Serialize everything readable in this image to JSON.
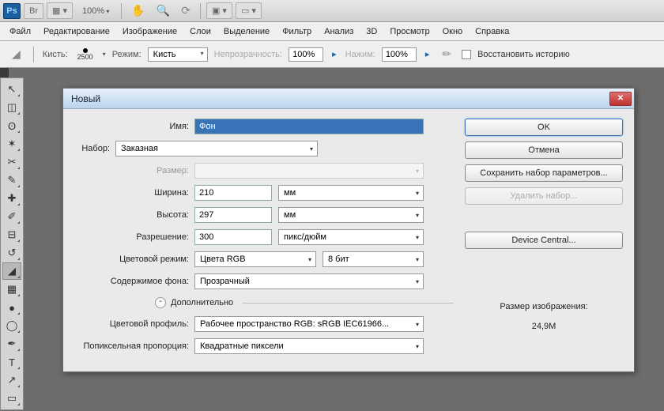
{
  "topbar": {
    "br": "Br",
    "zoom": "100%"
  },
  "menu": [
    "Файл",
    "Редактирование",
    "Изображение",
    "Слои",
    "Выделение",
    "Фильтр",
    "Анализ",
    "3D",
    "Просмотр",
    "Окно",
    "Справка"
  ],
  "options": {
    "brush_label": "Кисть:",
    "brush_size": "2500",
    "mode_label": "Режим:",
    "mode_value": "Кисть",
    "opacity_label": "Непрозрачность:",
    "opacity_value": "100%",
    "flow_label": "Нажим:",
    "flow_value": "100%",
    "restore": "Восстановить историю"
  },
  "dialog": {
    "title": "Новый",
    "labels": {
      "name": "Имя:",
      "preset": "Набор:",
      "size": "Размер:",
      "width": "Ширина:",
      "height": "Высота:",
      "resolution": "Разрешение:",
      "color_mode": "Цветовой режим:",
      "bg": "Содержимое фона:",
      "advanced": "Дополнительно",
      "profile": "Цветовой профиль:",
      "aspect": "Попиксельная пропорция:"
    },
    "values": {
      "name": "Фон",
      "preset": "Заказная",
      "width": "210",
      "width_unit": "мм",
      "height": "297",
      "height_unit": "мм",
      "resolution": "300",
      "resolution_unit": "пикс/дюйм",
      "color_mode": "Цвета RGB",
      "bit_depth": "8 бит",
      "bg": "Прозрачный",
      "profile": "Рабочее пространство RGB:  sRGB IEC61966...",
      "aspect": "Квадратные пиксели"
    },
    "buttons": {
      "ok": "OK",
      "cancel": "Отмена",
      "save_preset": "Сохранить набор параметров...",
      "delete_preset": "Удалить набор...",
      "device_central": "Device Central..."
    },
    "image_size_label": "Размер изображения:",
    "image_size_value": "24,9M"
  }
}
